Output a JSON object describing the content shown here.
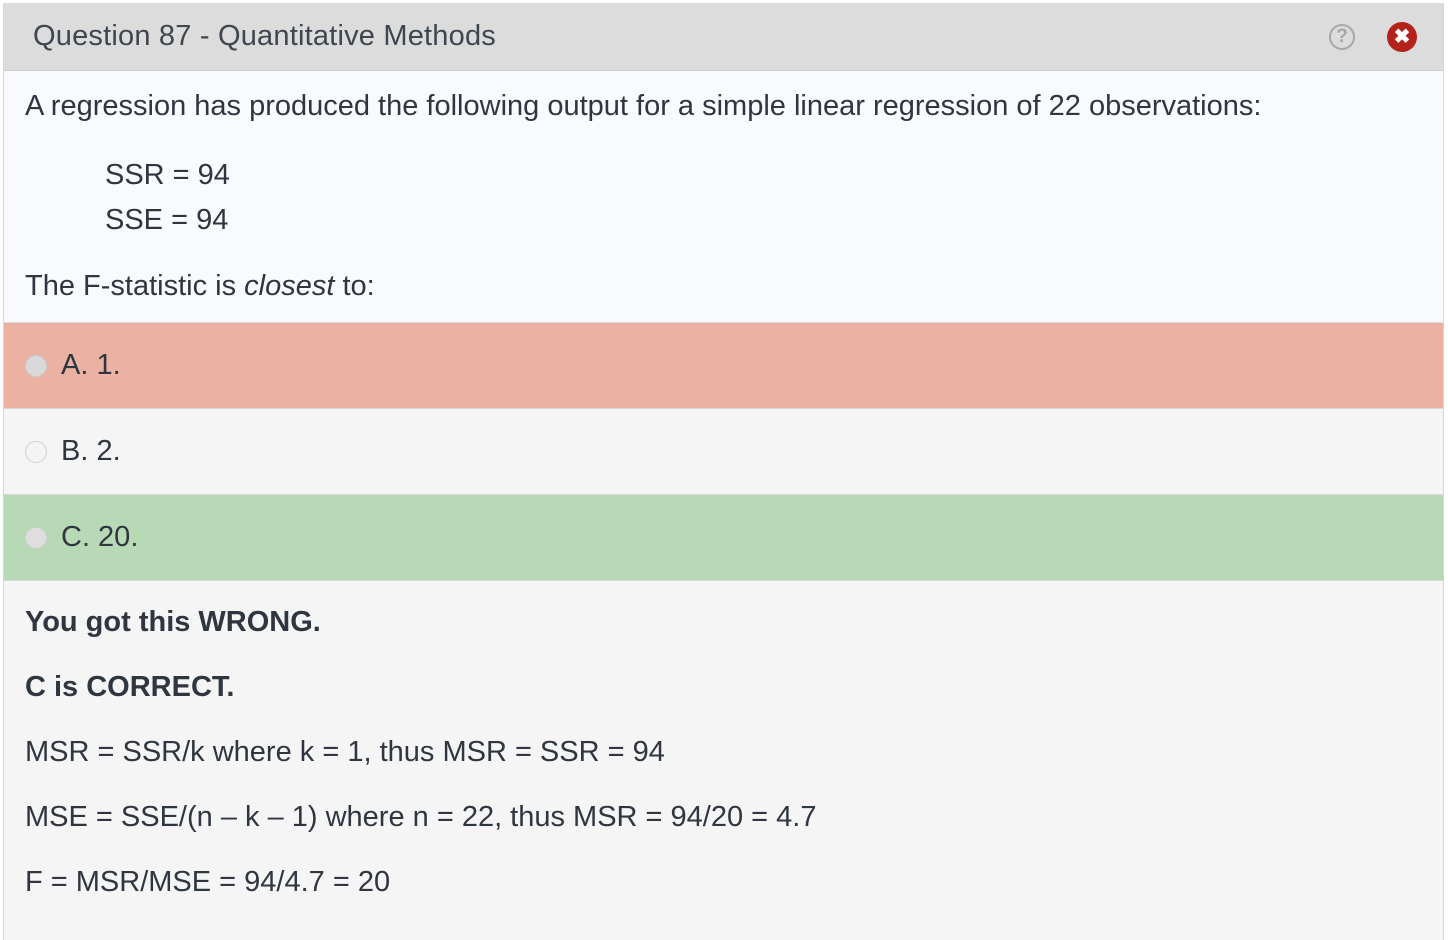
{
  "header": {
    "title": "Question 87 - Quantitative Methods",
    "help_glyph": "?",
    "close_glyph": "✖"
  },
  "question": {
    "text": "A regression has produced the following output for a simple linear regression of 22 observations:",
    "stats": [
      "SSR = 94",
      "SSE = 94"
    ],
    "stem_before": "The F-statistic is ",
    "stem_emphasis": "closest",
    "stem_after": " to:"
  },
  "options": [
    {
      "label": "A. 1.",
      "state": "wrong"
    },
    {
      "label": "B. 2.",
      "state": "neutral"
    },
    {
      "label": "C. 20.",
      "state": "correct"
    }
  ],
  "explanation": {
    "result": "You got this WRONG.",
    "correct": "C is CORRECT.",
    "lines": [
      "MSR = SSR/k where k = 1, thus MSR = SSR = 94",
      "MSE = SSE/(n – k – 1) where n = 22, thus MSR = 94/20 = 4.7",
      "F = MSR/MSE = 94/4.7 = 20"
    ]
  },
  "colors": {
    "wrong": "#ebb1a2",
    "correct": "#b8d9b5",
    "close_button": "#b3231b"
  },
  "icons": {
    "help": "help-circle-icon",
    "close": "close-circle-icon"
  }
}
